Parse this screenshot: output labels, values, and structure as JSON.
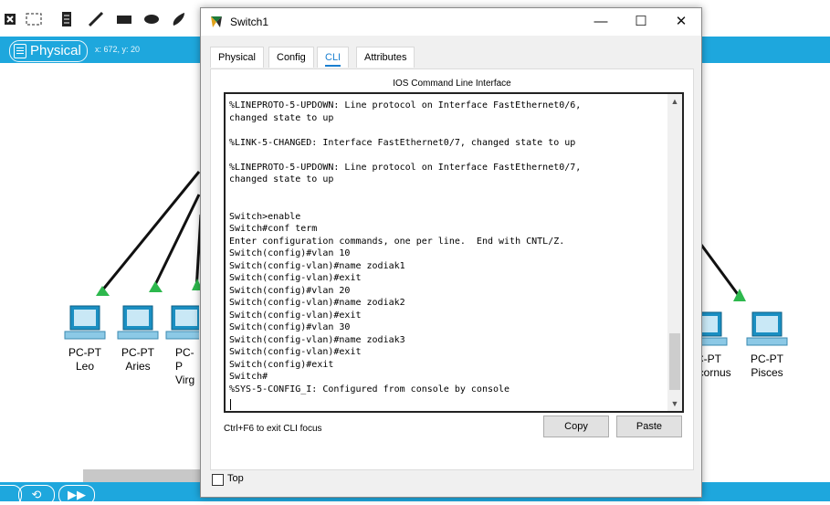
{
  "background": {
    "view_mode": "Physical",
    "coordinates": "x: 672, y: 20",
    "devices": [
      {
        "type": "PC-PT",
        "name": "Leo"
      },
      {
        "type": "PC-PT",
        "name": "Aries"
      },
      {
        "type": "PC-P",
        "name": "Virg"
      },
      {
        "type": "C-PT",
        "name": "icornus"
      },
      {
        "type": "PC-PT",
        "name": "Pisces"
      }
    ],
    "colors": {
      "bar": "#1ea7dd",
      "link_up": "#2db84d"
    }
  },
  "dialog": {
    "title": "Switch1",
    "controls": {
      "minimize": "—",
      "maximize": "☐",
      "close": "✕"
    },
    "tabs": [
      {
        "label": "Physical"
      },
      {
        "label": "Config"
      },
      {
        "label": "CLI",
        "active": true
      },
      {
        "label": "Attributes"
      }
    ],
    "cli_title": "IOS Command Line Interface",
    "console_text": "%LINEPROTO-5-UPDOWN: Line protocol on Interface FastEthernet0/6,\nchanged state to up\n\n%LINK-5-CHANGED: Interface FastEthernet0/7, changed state to up\n\n%LINEPROTO-5-UPDOWN: Line protocol on Interface FastEthernet0/7,\nchanged state to up\n\n\nSwitch>enable\nSwitch#conf term\nEnter configuration commands, one per line.  End with CNTL/Z.\nSwitch(config)#vlan 10\nSwitch(config-vlan)#name zodiak1\nSwitch(config-vlan)#exit\nSwitch(config)#vlan 20\nSwitch(config-vlan)#name zodiak2\nSwitch(config-vlan)#exit\nSwitch(config)#vlan 30\nSwitch(config-vlan)#name zodiak3\nSwitch(config-vlan)#exit\nSwitch(config)#exit\nSwitch#\n%SYS-5-CONFIG_I: Configured from console by console",
    "hint": "Ctrl+F6 to exit CLI focus",
    "copy_label": "Copy",
    "paste_label": "Paste",
    "top_label": "Top"
  }
}
